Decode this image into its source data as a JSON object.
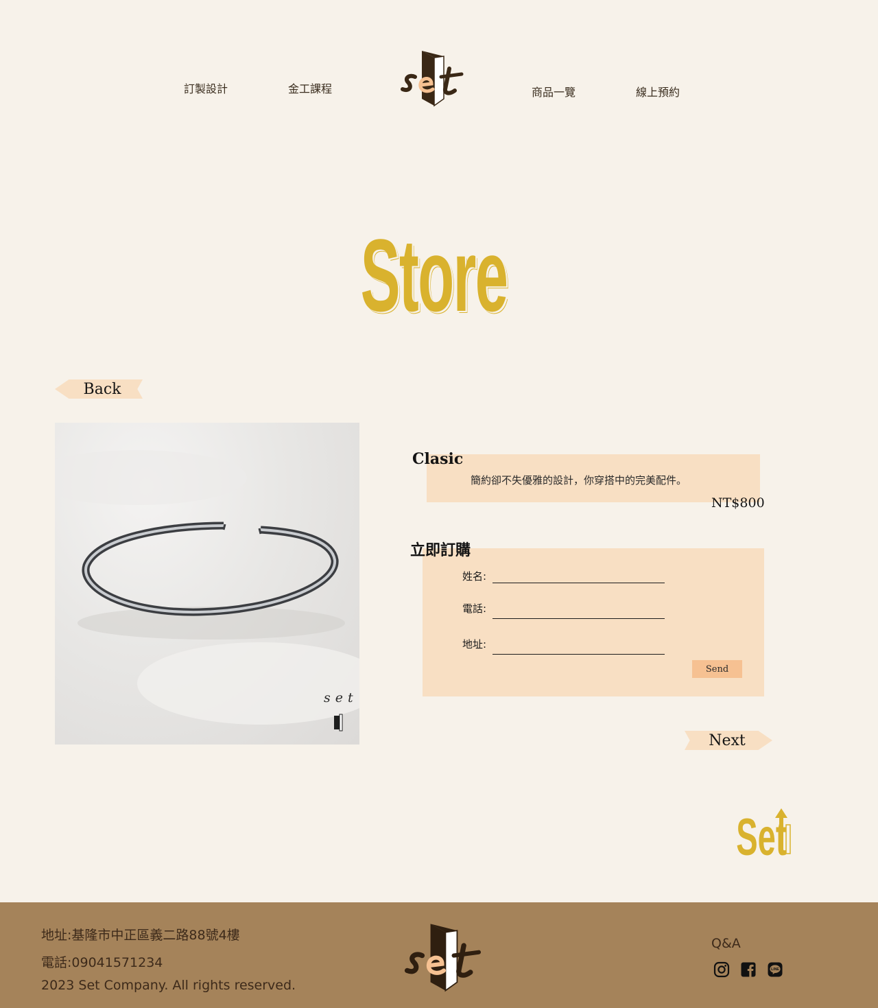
{
  "nav": {
    "items": [
      {
        "label": "訂製設計"
      },
      {
        "label": "金工課程"
      },
      {
        "label": "商品一覽"
      },
      {
        "label": "線上預約"
      }
    ],
    "logo_text": "set"
  },
  "hero": {
    "title": "Store"
  },
  "buttons": {
    "back": "Back",
    "next": "Next"
  },
  "product": {
    "name": "Clasic",
    "description": "簡約卻不失優雅的設計，你穿搭中的完美配件。",
    "price": "NT$800",
    "photo_watermark": "set"
  },
  "order_form": {
    "heading": "立即訂購",
    "fields": [
      {
        "label": "姓名:",
        "value": ""
      },
      {
        "label": "電話:",
        "value": ""
      },
      {
        "label": "地址:",
        "value": ""
      }
    ],
    "submit_label": "Send"
  },
  "brand_mark": "Set",
  "footer": {
    "address": "地址:基隆市中正區義二路88號4樓",
    "phone": "電話:09041571234",
    "copyright": "2023 Set Company. All rights reserved.",
    "qa_label": "Q&A",
    "social_icons": [
      "instagram-icon",
      "facebook-icon",
      "line-icon"
    ]
  },
  "colors": {
    "background": "#f7f2ea",
    "accent_gold": "#d9b22e",
    "peach": "#f8dfc3",
    "send_button": "#f6c192",
    "footer": "#a5835a",
    "logo_brown": "#3a2816"
  }
}
